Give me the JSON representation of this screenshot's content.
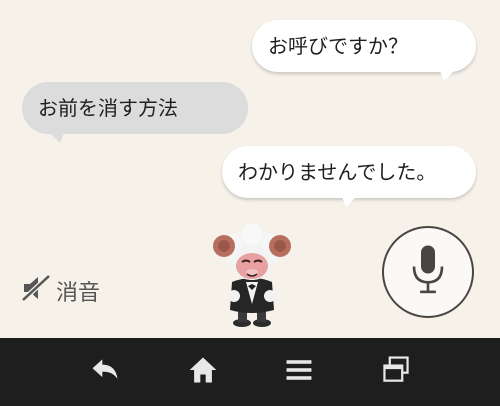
{
  "conversation": [
    {
      "speaker": "agent",
      "text": "お呼びですか？"
    },
    {
      "speaker": "user",
      "text": "お前を消す方法"
    },
    {
      "speaker": "agent",
      "text": "わかりませんでした。"
    }
  ],
  "mute_toggle": {
    "label": "消音",
    "icon": "speaker-muted-icon"
  },
  "mic_button": {
    "icon": "microphone-icon"
  },
  "mascot": {
    "icon": "sheep-mascot"
  },
  "navbar": {
    "buttons": [
      "back-icon",
      "home-icon",
      "menu-icon",
      "recents-icon"
    ]
  },
  "colors": {
    "background": "#f6f2ea",
    "agent_bubble": "#ffffff",
    "user_bubble": "#dcdcdc",
    "navbar": "#1e1e1e",
    "nav_icon": "#e8e8e8",
    "mic_icon": "#4a4443"
  }
}
